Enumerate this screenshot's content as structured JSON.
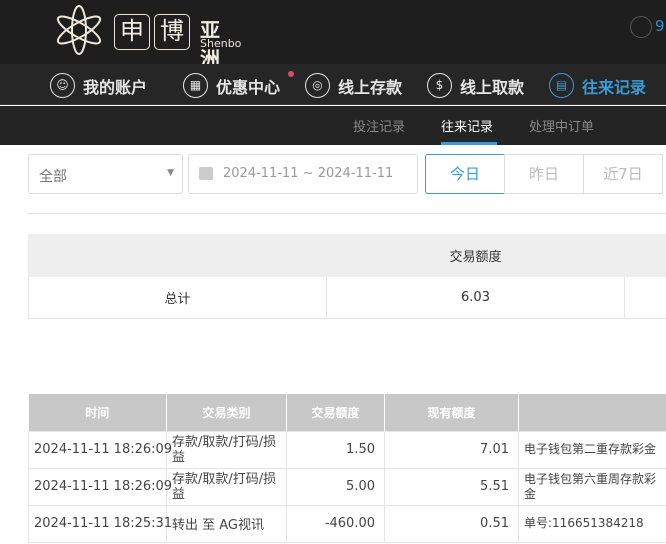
{
  "brand": {
    "box1": "申",
    "box2": "博",
    "name_cn": "亚洲",
    "name_en": "Shenbo"
  },
  "user": {
    "partial": "9"
  },
  "nav": [
    {
      "label": "我的账户",
      "icon": "user-icon"
    },
    {
      "label": "优惠中心",
      "icon": "gift-icon"
    },
    {
      "label": "线上存款",
      "icon": "deposit-icon"
    },
    {
      "label": "线上取款",
      "icon": "withdraw-icon"
    },
    {
      "label": "往来记录",
      "icon": "records-icon",
      "active": true
    }
  ],
  "subtabs": [
    {
      "label": "投注记录"
    },
    {
      "label": "往来记录",
      "active": true
    },
    {
      "label": "处理中订单"
    }
  ],
  "filters": {
    "type": "全部",
    "date_range": "2024-11-11 ~ 2024-11-11",
    "buttons": [
      "今日",
      "昨日",
      "近7日"
    ]
  },
  "summary": {
    "header": "交易额度",
    "label": "总计",
    "value": "6.03"
  },
  "table": {
    "headers": [
      "时间",
      "交易类别",
      "交易额度",
      "现有额度",
      ""
    ],
    "rows": [
      [
        "2024-11-11 18:26:09",
        "存款/取款/打码/损益",
        "1.50",
        "7.01",
        "电子钱包第二重存款彩金"
      ],
      [
        "2024-11-11 18:26:09",
        "存款/取款/打码/损益",
        "5.00",
        "5.51",
        "电子钱包第六重周存款彩金"
      ],
      [
        "2024-11-11 18:25:31",
        "转出 至 AG视讯",
        "-460.00",
        "0.51",
        "单号:116651384218"
      ]
    ]
  },
  "colors": {
    "accent": "#3a9ad9",
    "notify": "#e9446a"
  }
}
